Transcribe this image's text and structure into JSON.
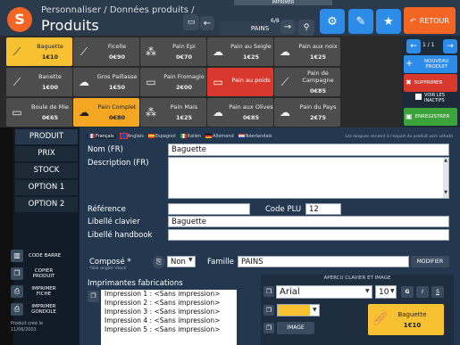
{
  "header": {
    "breadcrumb": "Personnaliser / Données produits /",
    "title": "Produits",
    "family_label": "PAINS",
    "family_page": "6/8",
    "top_partial": "IMPRIMER",
    "retour_label": "RETOUR"
  },
  "tiles": [
    {
      "name": "Baguette",
      "price": "1€10",
      "color": "yellow",
      "icon": "baguette-icon"
    },
    {
      "name": "Ficelle",
      "price": "0€90",
      "color": "gray",
      "icon": "ficelle-icon"
    },
    {
      "name": "Pain Epi",
      "price": "0€70",
      "color": "gray",
      "icon": "epi-icon"
    },
    {
      "name": "Pain au Seigle",
      "price": "1€25",
      "color": "gray",
      "icon": "bread-icon"
    },
    {
      "name": "Pain aux noix",
      "price": "1€25",
      "color": "gray",
      "icon": "bread-icon"
    },
    {
      "name": "Banette",
      "price": "1€00",
      "color": "gray",
      "icon": "baguette-icon"
    },
    {
      "name": "Gros Paillasse",
      "price": "1€50",
      "color": "gray",
      "icon": "bread-icon"
    },
    {
      "name": "Pain Fromagio",
      "price": "2€00",
      "color": "gray",
      "icon": "loaf-icon"
    },
    {
      "name": "Pain au poids",
      "price": "",
      "color": "red",
      "icon": "loaf-icon"
    },
    {
      "name": "Pain de Campagne",
      "price": "0€85",
      "color": "gray",
      "icon": "baguette-icon"
    },
    {
      "name": "Boule de Mie",
      "price": "0€65",
      "color": "gray",
      "icon": "loaf-icon"
    },
    {
      "name": "Pain Complet",
      "price": "0€80",
      "color": "orange",
      "icon": "bread-icon"
    },
    {
      "name": "Pain Mais",
      "price": "1€25",
      "color": "gray",
      "icon": "epi-icon"
    },
    {
      "name": "Pain aux Olives",
      "price": "0€85",
      "color": "gray",
      "icon": "bread-icon"
    },
    {
      "name": "Pain du Pays",
      "price": "2€75",
      "color": "gray",
      "icon": "bread-icon"
    }
  ],
  "right_panel": {
    "page": "1 / 1",
    "new_label": "NOUVEAU PRODUIT",
    "delete_label": "SUPPRIMER",
    "inactive_label": "VOIR LES INACTIFS",
    "save_label": "ENREGISTRER"
  },
  "sidebar": {
    "items": [
      "PRODUIT",
      "PRIX",
      "STOCK",
      "OPTION 1",
      "OPTION 2"
    ],
    "tools": [
      "CODE BARRE",
      "COPIER PRODUIT",
      "IMPRIMER FICHE",
      "IMPRIMER GONDOLE"
    ],
    "footer": "Produit créé le 11/06/2001"
  },
  "languages": {
    "items": [
      "Français",
      "Anglais",
      "Espagnol",
      "Italien",
      "Allemand",
      "Néerlandais"
    ],
    "note": "Les langues servent à l'export du produit vers véhuto"
  },
  "form": {
    "nom_label": "Nom (FR)",
    "nom_value": "Baguette",
    "desc_label": "Description (FR)",
    "ref_label": "Référence",
    "ref_value": "",
    "plu_label": "Code PLU",
    "plu_value": "12",
    "clavier_label": "Libellé clavier",
    "clavier_value": "Baguette",
    "handbook_label": "Libellé handbook",
    "handbook_value": "",
    "compose_label": "Composé *",
    "compose_note": "*Voir onglet 'stock'",
    "compose_value": "Non",
    "famille_label": "Famille",
    "famille_value": "PAINS",
    "modifier_label": "MODIFIER",
    "imprimantes_label": "Imprimantes fabrications",
    "impressions": [
      "Impression 1 : <Sans impression>",
      "Impression 2 : <Sans impression>",
      "Impression 3 : <Sans impression>",
      "Impression 4 : <Sans impression>",
      "Impression 5 : <Sans impression>"
    ]
  },
  "apercu": {
    "title": "APERCU CLAVIER ET IMAGE",
    "font_value": "Arial",
    "size_value": "10",
    "bold": "G",
    "italic": "I",
    "underline": "S",
    "image_label": "IMAGE",
    "preview_name": "Baguette",
    "preview_price": "1€10",
    "color": "#f7c132"
  }
}
